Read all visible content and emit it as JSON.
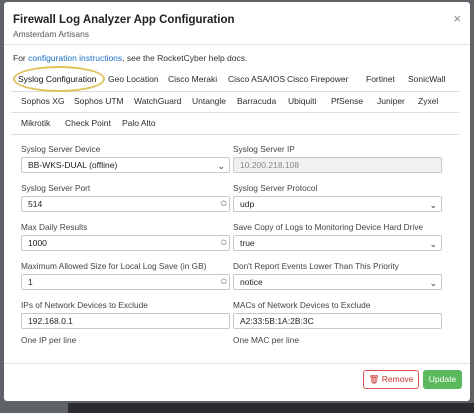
{
  "header": {
    "title": "Firewall Log Analyzer App Configuration",
    "subtitle": "Amsterdam Artisans",
    "close_symbol": "×"
  },
  "help": {
    "prefix": "For ",
    "link": "configuration instructions",
    "suffix": ", see the RocketCyber help docs."
  },
  "tabs": {
    "row1": [
      "Syslog Configuration",
      "Geo Location",
      "Cisco Meraki",
      "Cisco ASA/IOS",
      "Cisco Firepower",
      "Fortinet",
      "SonicWall"
    ],
    "row2": [
      "Sophos XG",
      "Sophos UTM",
      "WatchGuard",
      "Untangle",
      "Barracuda",
      "Ubiquiti",
      "PfSense",
      "Juniper",
      "Zyxel"
    ],
    "row3": [
      "Mikrotik",
      "Check Point",
      "Palo Alto"
    ],
    "active": "Syslog Configuration"
  },
  "form": {
    "syslog_device": {
      "label": "Syslog Server Device",
      "value": "BB-WKS-DUAL (offline)"
    },
    "syslog_ip": {
      "label": "Syslog Server IP",
      "value": "10.200.218.108"
    },
    "syslog_port": {
      "label": "Syslog Server Port",
      "value": "514"
    },
    "syslog_protocol": {
      "label": "Syslog Server Protocol",
      "value": "udp"
    },
    "max_daily": {
      "label": "Max Daily Results",
      "value": "1000"
    },
    "save_copy": {
      "label": "Save Copy of Logs to Monitoring Device Hard Drive",
      "value": "true"
    },
    "max_size": {
      "label": "Maximum Allowed Size for Local Log Save (in GB)",
      "value": "1"
    },
    "min_level": {
      "label": "Don't Report Events Lower Than This Priority",
      "value": "notice"
    },
    "exclude_ips": {
      "label": "IPs of Network Devices to Exclude",
      "value": "192.168.0.1",
      "hint": "One IP per line"
    },
    "exclude_macs": {
      "label": "MACs of Network Devices to Exclude",
      "value": "A2:33:5B:1A:2B:3C",
      "hint": "One MAC per line"
    }
  },
  "icons": {
    "chevron": "⌄",
    "spin_up": "︿",
    "spin_down": "﹀",
    "trash": "🗑"
  },
  "footer": {
    "remove_label": "Remove",
    "update_label": "Update"
  },
  "colors": {
    "link": "#1a6fc0",
    "remove": "#d9534f",
    "update": "#5cb85c",
    "highlight": "#e0c35a"
  }
}
